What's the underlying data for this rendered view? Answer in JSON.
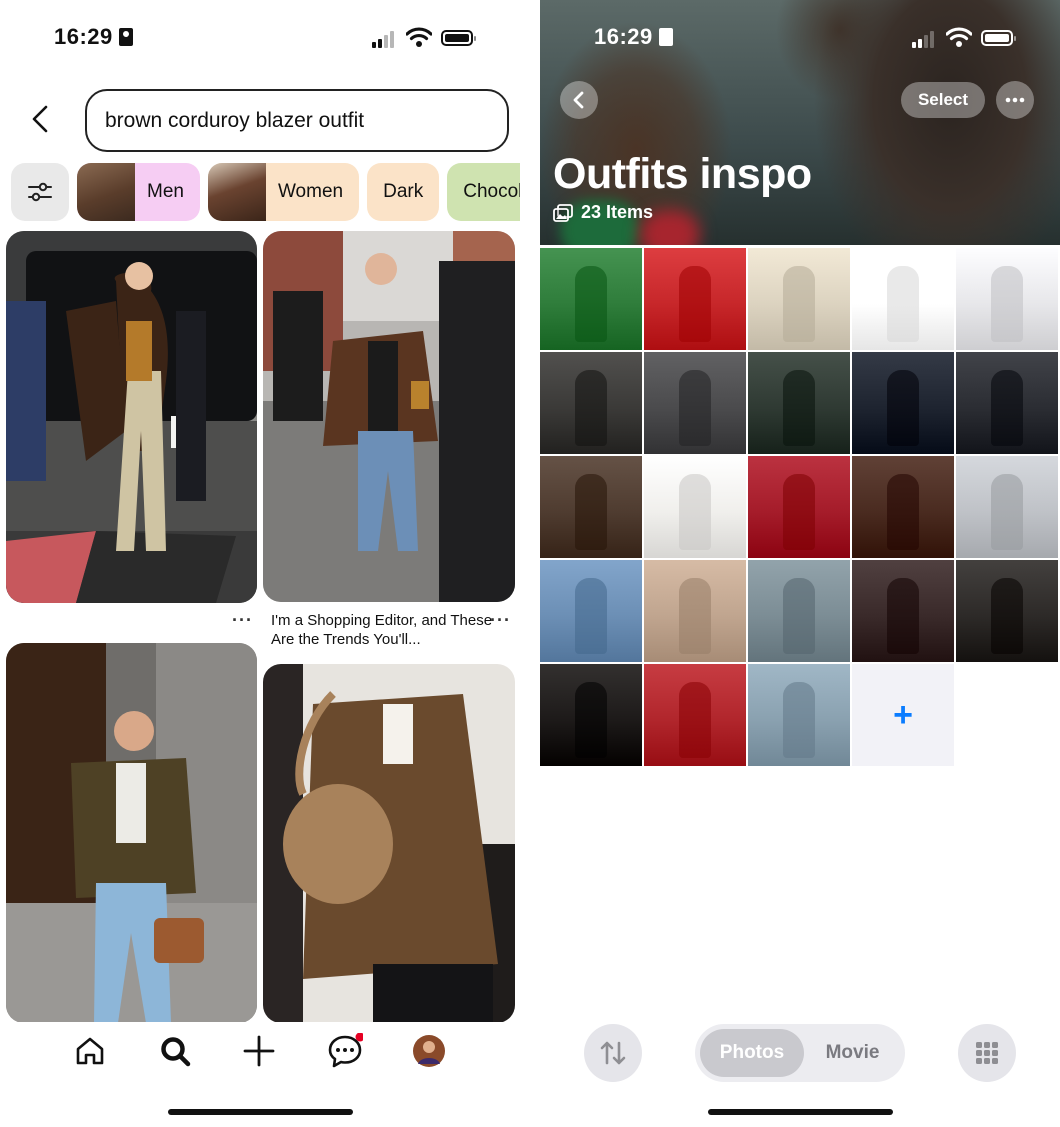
{
  "left": {
    "status": {
      "time": "16:29"
    },
    "search": {
      "query": "brown corduroy blazer outfit"
    },
    "chips": [
      {
        "label": "Men",
        "bg": "#f6cdf3",
        "thumb": "#6b4a36"
      },
      {
        "label": "Women",
        "bg": "#fbe3c8",
        "thumb": "#5a3a26"
      },
      {
        "label": "Dark",
        "bg": "#fbe3c8"
      },
      {
        "label": "Chocola",
        "bg": "#cfe3b0"
      }
    ],
    "pins": {
      "second_title": "I'm a Shopping Editor, and These Are the Trends You'll...",
      "more": "···"
    },
    "nav": [
      "home-icon",
      "search-icon",
      "plus-icon",
      "messages-icon",
      "profile-avatar"
    ]
  },
  "right": {
    "status": {
      "time": "16:29"
    },
    "header": {
      "select": "Select"
    },
    "album": {
      "title": "Outfits inspo",
      "count": "23 Items"
    },
    "grid_colors": [
      [
        "#2f7d3b",
        "#c7272a",
        "#dcd3c0",
        "#ffffff",
        "#e7e7ea"
      ],
      [
        "#3b3a38",
        "#4b4b4d",
        "#2f3a33",
        "#1e2430",
        "#2b2d33"
      ],
      [
        "#4f3c30",
        "#f0efec",
        "#a51c2a",
        "#4a2b20",
        "#bfc2c7"
      ],
      [
        "#6c8fb5",
        "#c0a58f",
        "#7c8d95",
        "#3a2a2a",
        "#2d2a28"
      ],
      [
        "#1d1a19",
        "#b1262c",
        "#8aa1b0"
      ]
    ],
    "bottom": {
      "photos": "Photos",
      "movie": "Movie"
    }
  }
}
